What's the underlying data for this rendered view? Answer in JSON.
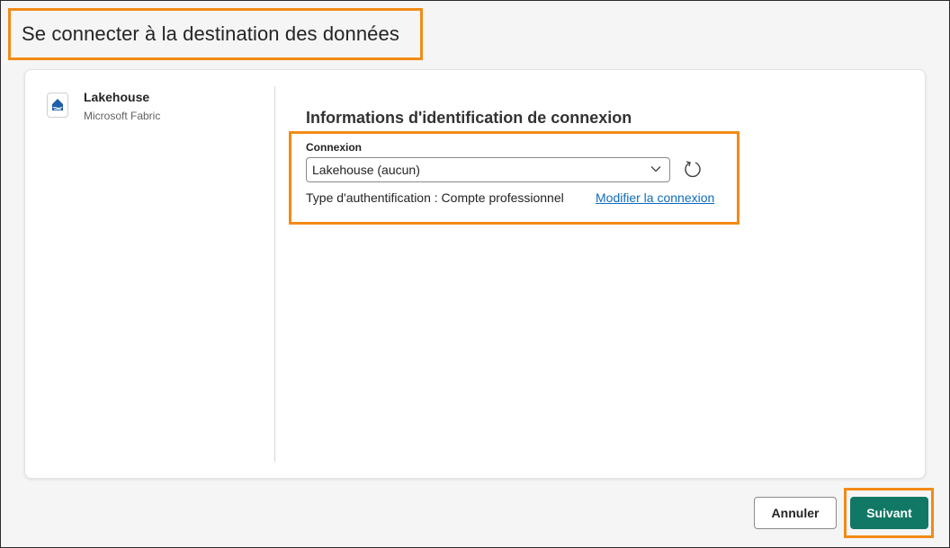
{
  "dialog": {
    "title": "Se connecter à la destination des données"
  },
  "source": {
    "name": "Lakehouse",
    "provider": "Microsoft Fabric",
    "icon": "lakehouse-icon"
  },
  "credentials": {
    "section_title": "Informations d'identification de connexion",
    "connection_label": "Connexion",
    "connection_value": "Lakehouse (aucun)",
    "auth_type_text": "Type d'authentification : Compte professionnel",
    "modify_link": "Modifier la connexion"
  },
  "footer": {
    "cancel_label": "Annuler",
    "next_label": "Suivant"
  },
  "colors": {
    "highlight": "#f28a17",
    "primary": "#117865",
    "link": "#0f6cbd"
  }
}
